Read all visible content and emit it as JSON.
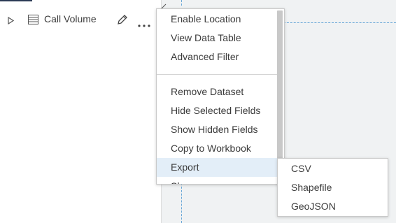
{
  "dataset": {
    "name": "Call Volume",
    "icons": {
      "expand": "caret-right-icon",
      "table": "table-icon",
      "edit": "pencil-icon",
      "more": "ellipsis-icon"
    }
  },
  "menu": {
    "items": [
      {
        "label": "Enable Location"
      },
      {
        "label": "View Data Table"
      },
      {
        "label": "Advanced Filter"
      },
      {
        "label": "Remove Dataset"
      },
      {
        "label": "Hide Selected Fields"
      },
      {
        "label": "Show Hidden Fields"
      },
      {
        "label": "Copy to Workbook"
      },
      {
        "label": "Export",
        "active": true
      },
      {
        "label": "Share"
      }
    ]
  },
  "submenu": {
    "items": [
      {
        "label": "CSV"
      },
      {
        "label": "Shapefile"
      },
      {
        "label": "GeoJSON"
      }
    ]
  },
  "colors": {
    "active_item": "#e3eef8",
    "canvas": "#f0f2f3",
    "guide": "#6aa8d8",
    "accent": "#2b3a55"
  }
}
